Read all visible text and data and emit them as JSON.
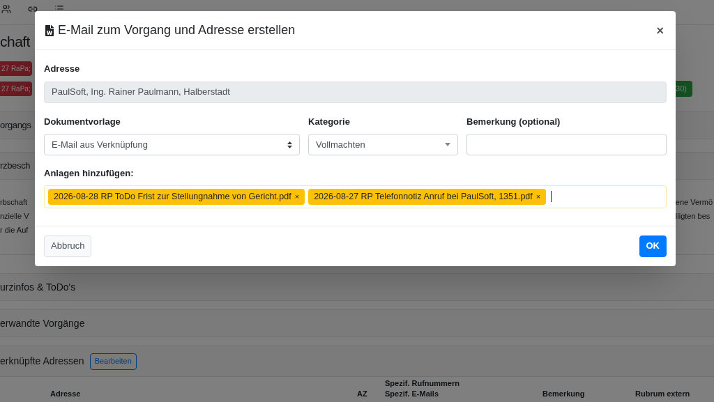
{
  "background": {
    "heading": "chaft",
    "left_badges": [
      "27 RaPa;",
      "27 RaPa;"
    ],
    "right_badge": "30)",
    "sections": [
      "organgs",
      "rzbesch"
    ],
    "description_left": [
      "rbschaft",
      "nzielle V",
      "r die Auf"
    ],
    "description_right": [
      "ene Vermö",
      "lligten bes"
    ],
    "panels": [
      "urzinfos & ToDo's",
      "erwandte Vorgänge"
    ],
    "linked": {
      "title": "erknüpfte Adressen",
      "button": "Bearbeiten"
    },
    "table": {
      "columns": [
        [
          "Adresse"
        ],
        [
          "AZ"
        ],
        [
          "Spezif. Rufnummern",
          "Spezif. E-Mails"
        ],
        [
          "Bemerkung"
        ],
        [
          "Rubrum extern"
        ]
      ]
    }
  },
  "modal": {
    "title": "E-Mail zum Vorgang und Adresse erstellen",
    "close": "×",
    "address": {
      "label": "Adresse",
      "value": "PaulSoft, Ing. Rainer Paulmann, Halberstadt"
    },
    "fields": [
      {
        "kind": "native-select",
        "label": "Dokumentvorlage",
        "value": "E-Mail aus Verknüpfung"
      },
      {
        "kind": "dropdown",
        "label": "Kategorie",
        "value": "Vollmachten"
      },
      {
        "kind": "text",
        "label": "Bemerkung (optional)"
      }
    ],
    "attachments": {
      "label": "Anlagen hinzufügen:",
      "tags": [
        {
          "text": "2026-08-28 RP ToDo Frist zur Stellungnahme von Gericht.pdf",
          "remove": "×"
        },
        {
          "text": "2026-08-27 RP Telefonnotiz Anruf bei PaulSoft, 1351.pdf",
          "remove": "×"
        }
      ]
    },
    "buttons": [
      {
        "kind": "secondary",
        "label": "Abbruch"
      },
      {
        "kind": "primary",
        "label": "OK"
      }
    ]
  }
}
